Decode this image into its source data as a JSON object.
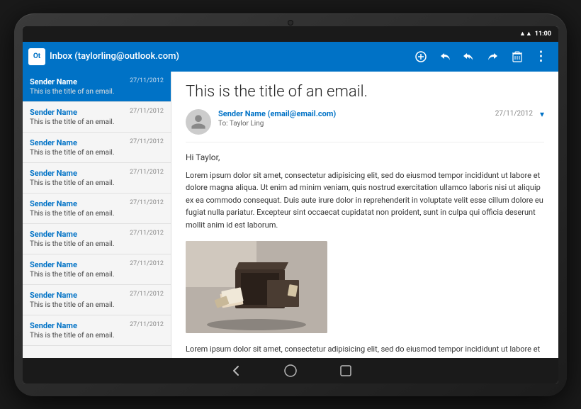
{
  "statusBar": {
    "time": "11:00",
    "wifiIcon": "▲",
    "batteryIcon": "▐"
  },
  "toolbar": {
    "appName": "Ot",
    "title": "Inbox (taylorling@outlook.com)",
    "addIcon": "+",
    "replyIcon": "↩",
    "replyAllIcon": "↩↩",
    "forwardIcon": "→",
    "deleteIcon": "🗑",
    "moreIcon": "⋮"
  },
  "emailList": {
    "emails": [
      {
        "sender": "Sender Name",
        "subject": "This is the title of an email.",
        "date": "27/11/2012",
        "selected": true
      },
      {
        "sender": "Sender Name",
        "subject": "This is the title of an email.",
        "date": "27/11/2012",
        "selected": false
      },
      {
        "sender": "Sender Name",
        "subject": "This is the title of an email.",
        "date": "27/11/2012",
        "selected": false
      },
      {
        "sender": "Sender Name",
        "subject": "This is the title of an email.",
        "date": "27/11/2012",
        "selected": false
      },
      {
        "sender": "Sender Name",
        "subject": "This is the title of an email.",
        "date": "27/11/2012",
        "selected": false
      },
      {
        "sender": "Sender Name",
        "subject": "This is the title of an email.",
        "date": "27/11/2012",
        "selected": false
      },
      {
        "sender": "Sender Name",
        "subject": "This is the title of an email.",
        "date": "27/11/2012",
        "selected": false
      },
      {
        "sender": "Sender Name",
        "subject": "This is the title of an email.",
        "date": "27/11/2012",
        "selected": false
      },
      {
        "sender": "Sender Name",
        "subject": "This is the title of an email.",
        "date": "27/11/2012",
        "selected": false
      }
    ]
  },
  "emailDetail": {
    "title": "This is the title of an email.",
    "from": "Sender Name (email@email.com)",
    "to": "To: Taylor Ling",
    "date": "27/11/2012",
    "greeting": "Hi Taylor,",
    "body1": "Lorem ipsum dolor sit amet, consectetur adipisicing elit, sed do eiusmod tempor incididunt ut labore et dolore magna aliqua. Ut enim ad minim veniam, quis nostrud exercitation ullamco laboris nisi ut aliquip ex ea commodo consequat. Duis aute irure dolor in reprehenderit in voluptate velit esse cillum dolore eu fugiat nulla pariatur. Excepteur sint occaecat cupidatat non proident, sunt in culpa qui officia deserunt mollit anim id est laborum.",
    "body2": "Lorem ipsum dolor sit amet, consectetur adipisicing elit, sed do eiusmod tempor incididunt ut labore et"
  },
  "navBar": {
    "backIcon": "◁",
    "homeIcon": "○",
    "recentIcon": "□"
  }
}
